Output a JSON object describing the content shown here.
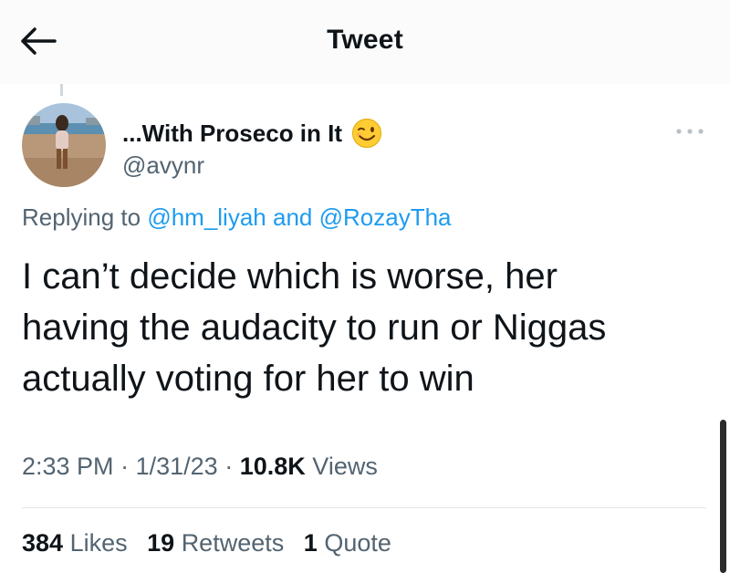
{
  "header": {
    "title": "Tweet",
    "back_icon": "arrow-left-icon"
  },
  "tweet": {
    "author": {
      "display_name": "...With Proseco in It",
      "emoji": "winking-face-emoji",
      "handle": "@avynr"
    },
    "reply": {
      "prefix": "Replying to",
      "mentions": [
        "@hm_liyah",
        "@RozayTha"
      ],
      "conjunction": "and"
    },
    "text_lines": [
      "I can’t decide which is worse, her",
      "having the audacity to run or Niggas",
      "actually voting for her to win"
    ],
    "meta": {
      "time": "2:33 PM",
      "date": "1/31/23",
      "views_count": "10.8K",
      "views_label": "Views"
    },
    "stats": {
      "likes": {
        "count": "384",
        "label": "Likes"
      },
      "retweets": {
        "count": "19",
        "label": "Retweets"
      },
      "quotes": {
        "count": "1",
        "label": "Quote"
      }
    }
  },
  "colors": {
    "link": "#1d9bf0",
    "secondary_text": "#536471",
    "primary_text": "#0f1419",
    "header_bg": "#fbfbfb"
  }
}
